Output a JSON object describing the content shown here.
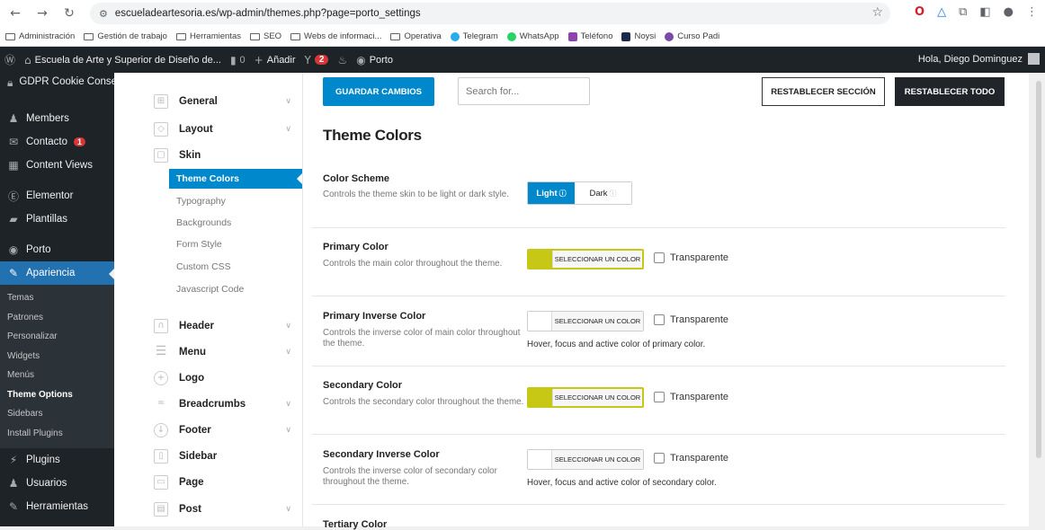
{
  "browser": {
    "url": "escueladeartesoria.es/wp-admin/themes.php?page=porto_settings",
    "bookmarks": [
      "Administración",
      "Gestión de trabajo",
      "Herramientas",
      "SEO",
      "Webs de informaci...",
      "Operativa",
      "Telegram",
      "WhatsApp",
      "Teléfono",
      "Noysi",
      "Curso Padi"
    ]
  },
  "adminbar": {
    "site_name": "Escuela de Arte y Superior de Diseño de...",
    "comments": "0",
    "add_new": "Añadir",
    "updates_badge": "2",
    "porto": "Porto",
    "greeting": "Hola, Diego Dominguez"
  },
  "wp_menu": {
    "items": [
      {
        "label": "GDPR Cookie Consent",
        "icon": "lock-icon"
      },
      {
        "label": "Members",
        "icon": "users-icon"
      },
      {
        "label": "Contacto",
        "icon": "mail-icon",
        "badge": "1"
      },
      {
        "label": "Content Views",
        "icon": "grid-icon"
      },
      {
        "label": "Elementor",
        "icon": "elementor-icon"
      },
      {
        "label": "Plantillas",
        "icon": "folder-icon"
      },
      {
        "label": "Porto",
        "icon": "porto-icon"
      },
      {
        "label": "Apariencia",
        "icon": "brush-icon"
      }
    ],
    "submenu": [
      "Temas",
      "Patrones",
      "Personalizar",
      "Widgets",
      "Menús",
      "Theme Options",
      "Sidebars",
      "Install Plugins"
    ],
    "current_sub": "Theme Options",
    "bottom_items": [
      {
        "label": "Plugins",
        "icon": "plug-icon"
      },
      {
        "label": "Usuarios",
        "icon": "user-icon"
      },
      {
        "label": "Herramientas",
        "icon": "wrench-icon"
      }
    ]
  },
  "porto_sidebar": {
    "general": "General",
    "layout": "Layout",
    "skin": "Skin",
    "skin_sub": [
      "Theme Colors",
      "Typography",
      "Backgrounds",
      "Form Style",
      "Custom CSS",
      "Javascript Code"
    ],
    "header": "Header",
    "menu": "Menu",
    "logo": "Logo",
    "breadcrumbs": "Breadcrumbs",
    "footer": "Footer",
    "sidebar": "Sidebar",
    "page": "Page",
    "post": "Post"
  },
  "toolbar": {
    "save": "GUARDAR CAMBIOS",
    "search_placeholder": "Search for...",
    "reset_section": "RESTABLECER SECCIÓN",
    "reset_all": "RESTABLECER TODO"
  },
  "section_title": "Theme Colors",
  "color_scheme": {
    "title": "Color Scheme",
    "desc": "Controls the theme skin to be light or dark style.",
    "light": "Light",
    "dark": "Dark",
    "selected": "Light"
  },
  "options": [
    {
      "title": "Primary Color",
      "desc": "Controls the main color throughout the theme.",
      "button": "SELECCIONAR UN COLOR",
      "swatch": "#c7c716",
      "transparent": "Transparente",
      "hint": ""
    },
    {
      "title": "Primary Inverse Color",
      "desc": "Controls the inverse color of main color throughout the theme.",
      "button": "SELECCIONAR UN COLOR",
      "swatch": "#ffffff",
      "transparent": "Transparente",
      "hint": "Hover, focus and active color of primary color."
    },
    {
      "title": "Secondary Color",
      "desc": "Controls the secondary color throughout the theme.",
      "button": "SELECCIONAR UN COLOR",
      "swatch": "#c7c716",
      "transparent": "Transparente",
      "hint": ""
    },
    {
      "title": "Secondary Inverse Color",
      "desc": "Controls the inverse color of secondary color throughout the theme.",
      "button": "SELECCIONAR UN COLOR",
      "swatch": "#ffffff",
      "transparent": "Transparente",
      "hint": "Hover, focus and active color of secondary color."
    }
  ],
  "next_option_title": "Tertiary Color",
  "colors": {
    "wp_dark": "#1d2327",
    "wp_blue": "#2271b1",
    "porto_blue": "#0088cc",
    "accent_yellow": "#c7c716"
  }
}
